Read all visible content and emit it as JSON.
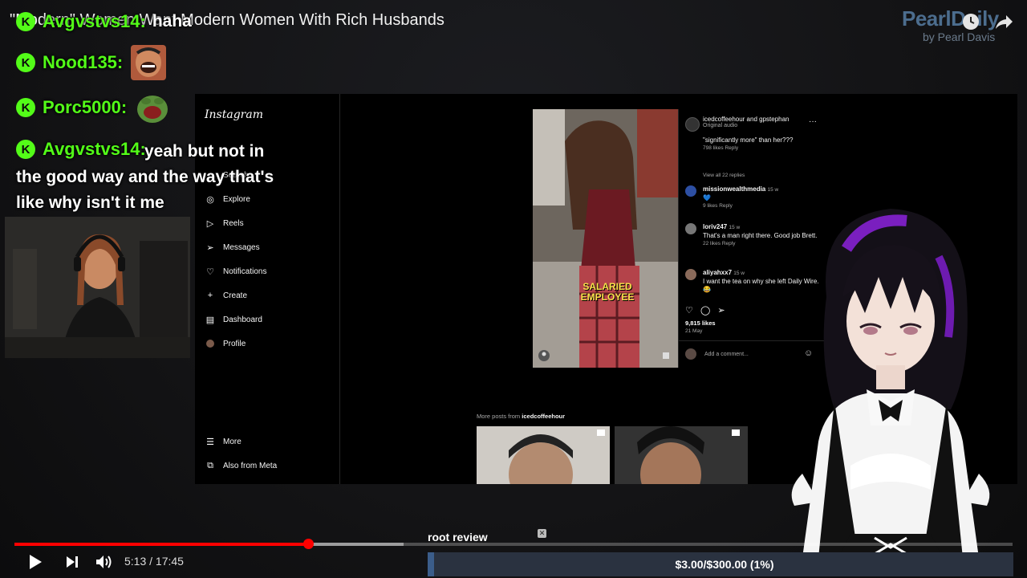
{
  "video": {
    "title": "\"Modern\" Women Want Modern Women With Rich Husbands",
    "current_time": "5:13",
    "duration": "17:45",
    "time_display": "5:13 / 17:45",
    "progress_fraction": 0.294,
    "buffer_fraction": 0.39
  },
  "brand": {
    "name": "PearlDaily",
    "byline": "by Pearl Davis"
  },
  "chat": {
    "messages": [
      {
        "user": "Avgvstvs14:",
        "text": "haha"
      },
      {
        "user": "Nood135:",
        "emote": "laughing-man-emote"
      },
      {
        "user": "Porc5000:",
        "emote": "pepe-laugh-emote"
      },
      {
        "user": "Avgvstvs14:",
        "text": "yeah but not in the good way and the way that's like why isn't it me"
      }
    ]
  },
  "instagram": {
    "logo": "Instagram",
    "nav": [
      {
        "label": "Search",
        "icon": "search-icon"
      },
      {
        "label": "Explore",
        "icon": "compass-icon"
      },
      {
        "label": "Reels",
        "icon": "reels-icon"
      },
      {
        "label": "Messages",
        "icon": "send-icon"
      },
      {
        "label": "Notifications",
        "icon": "heart-icon"
      },
      {
        "label": "Create",
        "icon": "plus-icon"
      },
      {
        "label": "Dashboard",
        "icon": "chart-icon"
      },
      {
        "label": "Profile",
        "icon": "avatar-icon"
      }
    ],
    "bottom_nav": [
      {
        "label": "More",
        "icon": "menu-icon"
      },
      {
        "label": "Also from Meta",
        "icon": "meta-icon"
      }
    ],
    "post": {
      "caption_overlay": "SALARIED EMPLOYEE",
      "author": "icedcoffeehour and gpstephan",
      "audio": "Original audio",
      "likes": "9,815 likes",
      "date": "21 May",
      "add_comment_placeholder": "Add a comment..."
    },
    "comments": [
      {
        "text": "\"significantly more\" than her???",
        "meta": "798 likes   Reply"
      },
      {
        "text": "View all 22 replies"
      },
      {
        "user": "missionwealthmedia",
        "age": "15 w",
        "text": "💙",
        "meta": "9 likes   Reply"
      },
      {
        "user": "loriv247",
        "age": "15 w",
        "text": "That's a man right there. Good job Brett.",
        "meta": "22 likes   Reply"
      },
      {
        "user": "aliyahxx7",
        "age": "15 w",
        "text": "I want the tea on why she left Daily Wire. 😂"
      }
    ],
    "more_posts_label": "More posts from",
    "more_posts_user": "icedcoffeehour"
  },
  "goal": {
    "label": "root review",
    "text": "$3.00/$300.00 (1%)",
    "fraction": 0.01
  },
  "colors": {
    "kick_green": "#53fc18",
    "yt_red": "#ff0000",
    "goal_bar": "#3b5d8a"
  }
}
